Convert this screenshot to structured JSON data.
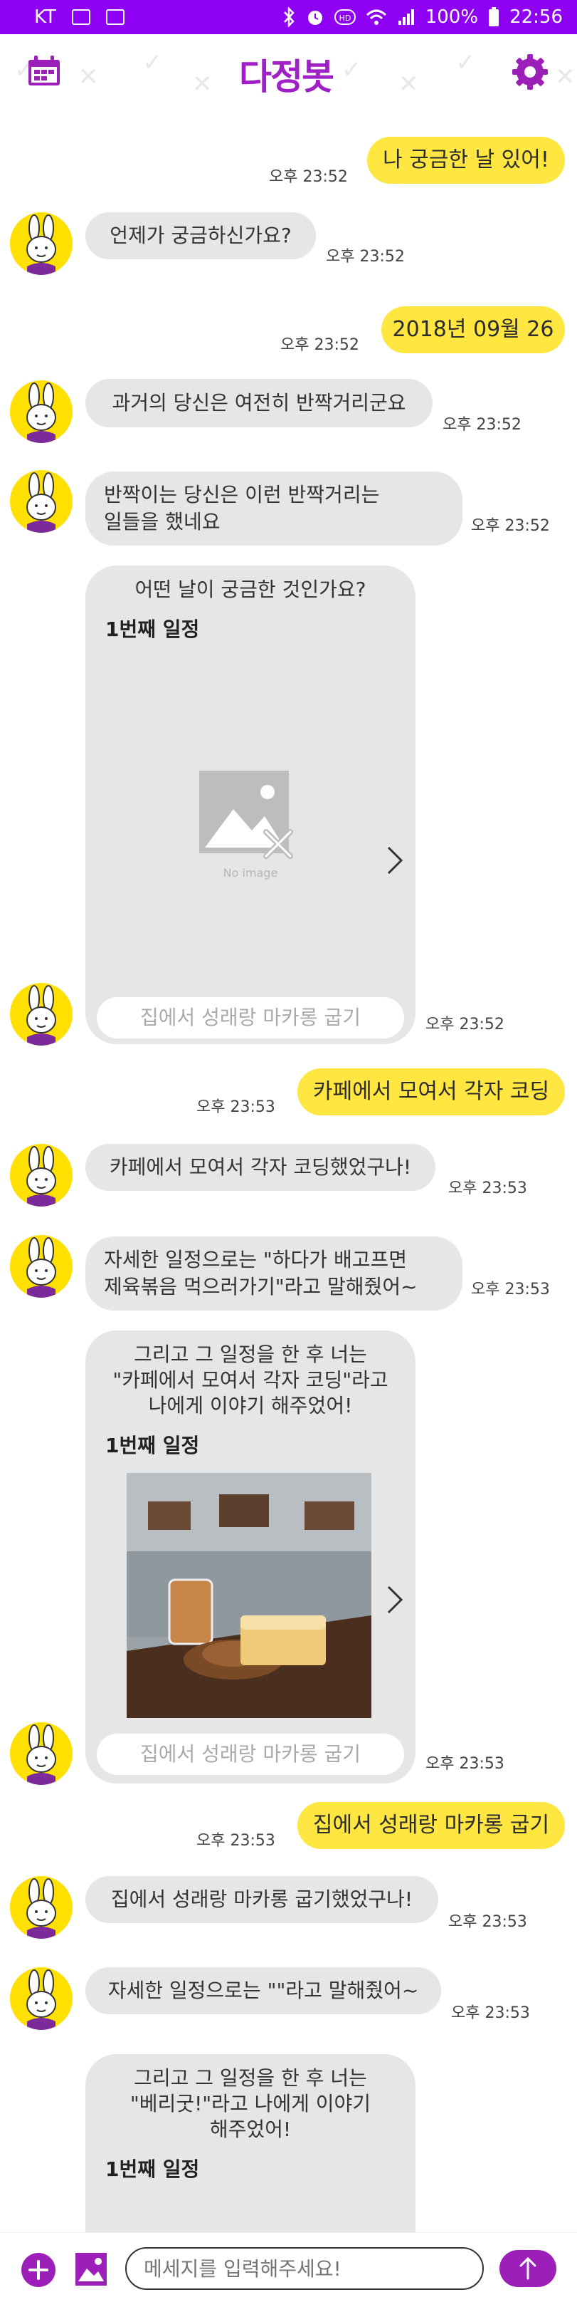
{
  "status_bar": {
    "carrier": "KT",
    "battery": "100%",
    "time": "22:56"
  },
  "header": {
    "logo_text": "다정봇"
  },
  "colors": {
    "status_bar": "#8e00f2",
    "brand_purple": "#9b1fb8",
    "user_bubble": "#ffe640",
    "bot_bubble": "#e6e6e6"
  },
  "messages": [
    {
      "from": "user",
      "text": "나 궁금한 날 있어!",
      "time": "오후 23:52"
    },
    {
      "from": "bot",
      "text": "언제가 궁금하신가요?",
      "time": "오후 23:52"
    },
    {
      "from": "user",
      "text": "2018년 09월 26",
      "time": "오후 23:52"
    },
    {
      "from": "bot",
      "text": "과거의 당신은 여전히 반짝거리군요",
      "time": "오후 23:52"
    },
    {
      "from": "bot",
      "line1": "반짝이는 당신은 이런 반짝거리는",
      "line2": "일들을 했네요",
      "time": "오후 23:52"
    },
    {
      "from": "bot-card",
      "question": "어떤 날이 궁금한 것인가요?",
      "schedule_label": "1번째 일정",
      "image_caption": "No image",
      "button": "집에서 성래랑 마카롱 굽기",
      "time": "오후 23:52"
    },
    {
      "from": "user",
      "text": "카페에서 모여서 각자 코딩",
      "time": "오후 23:53"
    },
    {
      "from": "bot",
      "text": "카페에서 모여서 각자 코딩했었구나!",
      "time": "오후 23:53"
    },
    {
      "from": "bot",
      "line1": "자세한 일정으로는 \"하다가 배고프면",
      "line2": "제육볶음 먹으러가기\"라고 말해줬어~",
      "time": "오후 23:53"
    },
    {
      "from": "bot-card",
      "line1": "그리고 그 일정을 한 후 너는",
      "line2": "\"카페에서 모여서 각자 코딩\"라고",
      "line3": "나에게 이야기 해주었어!",
      "schedule_label": "1번째 일정",
      "button": "집에서 성래랑 마카롱 굽기",
      "time": "오후 23:53"
    },
    {
      "from": "user",
      "text": "집에서 성래랑 마카롱 굽기",
      "time": "오후 23:53"
    },
    {
      "from": "bot",
      "text": "집에서 성래랑 마카롱 굽기했었구나!",
      "time": "오후 23:53"
    },
    {
      "from": "bot",
      "text": "자세한 일정으로는 \"\"라고 말해줬어~",
      "time": "오후 23:53"
    },
    {
      "from": "bot-card",
      "line1": "그리고 그 일정을 한 후 너는",
      "line2": "\"베리굿!\"라고 나에게 이야기",
      "line3": "해주었어!",
      "schedule_label": "1번째 일정"
    }
  ],
  "input": {
    "placeholder": "메세지를 입력해주세요!"
  },
  "icons": {
    "calendar": "calendar-icon",
    "settings": "gear-icon",
    "add": "plus-icon",
    "image": "image-icon",
    "send": "arrow-up-icon"
  }
}
